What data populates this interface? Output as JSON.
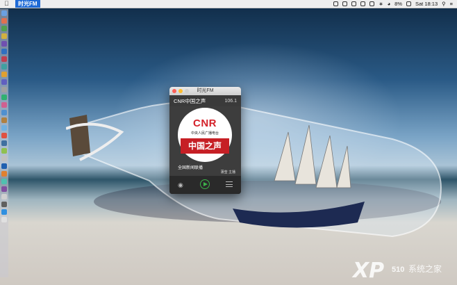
{
  "menubar": {
    "app_name": "时光FM",
    "battery": "8%",
    "clock": "Sat 18:13"
  },
  "icons": {
    "apple": "apple-icon",
    "wifi": "wifi-icon",
    "bluetooth": "bluetooth-icon",
    "search": "search-icon",
    "notification": "notification-center-icon"
  },
  "window": {
    "title": "时光FM",
    "station_name": "CNR中国之声",
    "frequency": "106.1",
    "logo_text": "CNR",
    "logo_subtitle": "中央人民广播电台",
    "logo_channel": "中国之声",
    "program_name": "全国新闻联播",
    "host_name": "蒲莹 主播"
  },
  "watermark": {
    "brand": "XP",
    "number": "510",
    "text": "系统之家"
  },
  "colors": {
    "accent_play": "#3cb44a",
    "cnr_red": "#d4222a",
    "menubar_highlight": "#1e6ad6"
  }
}
